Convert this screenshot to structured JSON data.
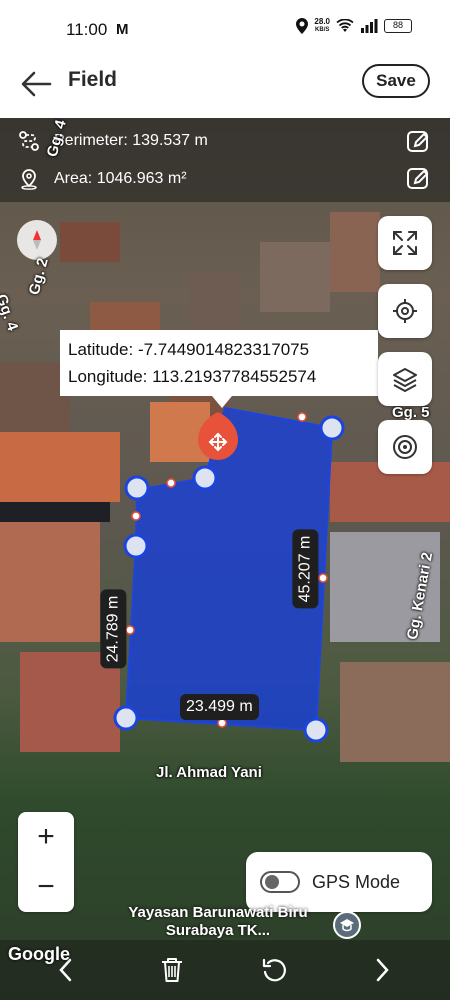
{
  "status": {
    "time": "11:00",
    "mail_icon": "M",
    "speed_value": "28.0",
    "speed_unit": "KB/S",
    "battery": "88"
  },
  "header": {
    "title": "Field",
    "save_label": "Save"
  },
  "info": {
    "perimeter": "Perimeter: 139.537 m",
    "area": "Area: 1046.963 m²"
  },
  "coordinates": {
    "latitude": "Latitude: -7.7449014823317075",
    "longitude": "Longitude: 113.21937784552574"
  },
  "dimensions": {
    "right": "45.207 m",
    "left": "24.789 m",
    "bottom": "23.499 m"
  },
  "streets": {
    "gg4_top": "Gg. 4",
    "gg2": "Gg. 2",
    "gg4_left": "Gg. 4",
    "gg5": "Gg. 5",
    "kenari": "Gg. Kenari 2",
    "ahmad_yani": "Jl. Ahmad Yani"
  },
  "place": {
    "line1": "Yayasan Barunawati Biru",
    "line2": "Surabaya TK..."
  },
  "google": "Google",
  "gps_mode": {
    "label": "GPS Mode",
    "enabled": false
  },
  "zoom": {
    "in": "+",
    "out": "−"
  },
  "colors": {
    "polygon_fill": "#1a3fd6",
    "vertex_stroke": "#1b44e0",
    "marker": "#e8523a"
  },
  "icons": {
    "back": "arrow-left-icon",
    "perimeter": "route-icon",
    "area": "location-pin-icon",
    "edit": "pencil-edit-icon",
    "fullscreen": "fullscreen-icon",
    "locate": "crosshair-icon",
    "layers": "layers-icon",
    "target": "target-icon",
    "move": "move-arrows-icon",
    "compass": "compass-icon",
    "prev": "chevron-left-icon",
    "delete": "trash-icon",
    "undo": "undo-icon",
    "next": "chevron-right-icon"
  }
}
